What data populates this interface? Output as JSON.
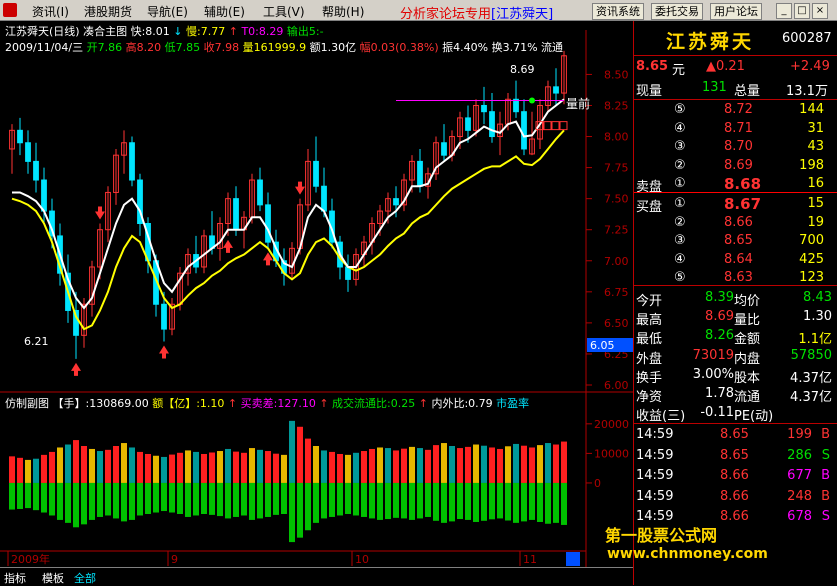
{
  "menubar": {
    "items": [
      "资讯(I)",
      "港股期货",
      "导航(E)",
      "辅助(E)",
      "工具(V)",
      "帮助(H)"
    ],
    "promo": "分析家论坛专用",
    "promo_bracket": "[江苏舜天]",
    "buttons": [
      "资讯系统",
      "委托交易",
      "用户论坛"
    ],
    "controls": [
      "_",
      "□",
      "×"
    ]
  },
  "header": {
    "line1": {
      "title": "江苏舜天(日线)",
      "indicator": "凑合主图",
      "fast": "快:8.01",
      "slow": "慢:7.77",
      "t0": "T0:8.29",
      "output": "输出5:-"
    },
    "line2": {
      "date": "2009/11/04/三",
      "open": "开7.86",
      "high": "高8.20",
      "low": "低7.85",
      "close": "收7.98",
      "volume": "量161999.9",
      "amount": "额1.30亿",
      "change": "幅0.03(0.38%)",
      "amplitude": "振4.40%",
      "turnover": "换3.71%",
      "float": "流通"
    },
    "annot_high": "8.69",
    "annot_low": "6.21",
    "annot_right": "量前"
  },
  "price_axis": {
    "ticks": [
      "8.50",
      "8.25",
      "8.00",
      "7.75",
      "7.50",
      "7.25",
      "7.00",
      "6.75",
      "6.50",
      "6.25",
      "6.00"
    ],
    "current_tag": "6.05"
  },
  "sub_indicator": {
    "name": "仿制副图",
    "hand": "【手】:130869.00",
    "amount": "额【亿】:1.10",
    "buysell": "买卖差:127.10",
    "float_ratio": "成交流通比:0.25",
    "inout_ratio": "内外比:0.79",
    "pe": "市盈率",
    "axis": [
      "20000",
      "10000",
      "0"
    ]
  },
  "time_axis": [
    "2009年",
    "9",
    "10",
    "11"
  ],
  "bottom_tabs": [
    "指标",
    "模板",
    "全部"
  ],
  "quote": {
    "name": "江苏舜天",
    "code": "600287",
    "price": "8.65",
    "price_unit": "元",
    "change": "▲0.21",
    "change_pct": "+2.49",
    "now_vol_label": "现量",
    "now_vol": "131",
    "total_vol_label": "总量",
    "total_vol": "13.1万",
    "asks": [
      {
        "level": "⑤",
        "price": "8.72",
        "vol": "144"
      },
      {
        "level": "④",
        "price": "8.71",
        "vol": "31"
      },
      {
        "level": "③",
        "price": "8.70",
        "vol": "43"
      },
      {
        "level": "②",
        "price": "8.69",
        "vol": "198"
      },
      {
        "level": "①",
        "price": "8.68",
        "vol": "16",
        "label": "卖盘"
      }
    ],
    "bids": [
      {
        "level": "①",
        "price": "8.67",
        "vol": "15",
        "label": "买盘"
      },
      {
        "level": "②",
        "price": "8.66",
        "vol": "19"
      },
      {
        "level": "③",
        "price": "8.65",
        "vol": "700"
      },
      {
        "level": "④",
        "price": "8.64",
        "vol": "425"
      },
      {
        "level": "⑤",
        "price": "8.63",
        "vol": "123"
      }
    ],
    "stats": [
      {
        "l1": "今开",
        "v1": "8.39",
        "l2": "均价",
        "v2": "8.43",
        "c1": "#00e000",
        "c2": "#00e000"
      },
      {
        "l1": "最高",
        "v1": "8.69",
        "l2": "量比",
        "v2": "1.30",
        "c1": "#ff3333",
        "c2": "#ffffff"
      },
      {
        "l1": "最低",
        "v1": "8.26",
        "l2": "金额",
        "v2": "1.1亿",
        "c1": "#00e000",
        "c2": "#ffff00"
      },
      {
        "l1": "外盘",
        "v1": "73019",
        "l2": "内盘",
        "v2": "57850",
        "c1": "#ff3333",
        "c2": "#00e000"
      },
      {
        "l1": "换手",
        "v1": "3.00%",
        "l2": "股本",
        "v2": "4.37亿",
        "c1": "#ffffff",
        "c2": "#ffffff"
      },
      {
        "l1": "净资",
        "v1": "1.78",
        "l2": "流通",
        "v2": "4.37亿",
        "c1": "#ffffff",
        "c2": "#ffffff"
      },
      {
        "l1": "收益(三)",
        "v1": "-0.11",
        "l2": "PE(动)",
        "v2": "",
        "c1": "#ffffff",
        "c2": "#ffffff"
      }
    ],
    "ticks": [
      {
        "time": "14:59",
        "price": "8.65",
        "vol": "199",
        "flag": "B",
        "fc": "#ff3333"
      },
      {
        "time": "14:59",
        "price": "8.65",
        "vol": "286",
        "flag": "S",
        "fc": "#00e000"
      },
      {
        "time": "14:59",
        "price": "8.66",
        "vol": "677",
        "flag": "B",
        "fc": "#ff00ff"
      },
      {
        "time": "14:59",
        "price": "8.66",
        "vol": "248",
        "flag": "B",
        "fc": "#ff3333"
      },
      {
        "time": "14:59",
        "price": "8.66",
        "vol": "678",
        "flag": "S",
        "fc": "#ff00ff"
      }
    ]
  },
  "watermark": {
    "line1": "第一股票公式网",
    "line2": "www.chnmoney.com"
  },
  "colors": {
    "up": "#ff3333",
    "down": "#00e5ff",
    "fast_line": "#ffffff",
    "slow_line": "#ffff00",
    "vol_up": "#ff2020",
    "vol_alt": "#e8b800",
    "vol_teal": "#009999",
    "vol_neg": "#00c000"
  },
  "chart_data": {
    "type": "candlestick",
    "ylim": [
      6.0,
      8.6
    ],
    "candles": [
      [
        7.9,
        8.1,
        7.7,
        8.05
      ],
      [
        8.05,
        8.15,
        7.85,
        7.95
      ],
      [
        7.95,
        8.05,
        7.7,
        7.8
      ],
      [
        7.8,
        7.95,
        7.55,
        7.65
      ],
      [
        7.65,
        7.75,
        7.3,
        7.4
      ],
      [
        7.4,
        7.5,
        7.1,
        7.2
      ],
      [
        7.2,
        7.3,
        6.8,
        6.9
      ],
      [
        6.9,
        7.05,
        6.5,
        6.6
      ],
      [
        6.6,
        6.75,
        6.21,
        6.4
      ],
      [
        6.4,
        6.7,
        6.3,
        6.65
      ],
      [
        6.65,
        7.0,
        6.55,
        6.95
      ],
      [
        6.95,
        7.3,
        6.85,
        7.25
      ],
      [
        7.25,
        7.6,
        7.15,
        7.55
      ],
      [
        7.55,
        7.9,
        7.45,
        7.85
      ],
      [
        7.85,
        8.05,
        7.7,
        7.95
      ],
      [
        7.95,
        8.0,
        7.6,
        7.65
      ],
      [
        7.65,
        7.7,
        7.2,
        7.3
      ],
      [
        7.3,
        7.35,
        6.9,
        7.0
      ],
      [
        7.0,
        7.05,
        6.55,
        6.65
      ],
      [
        6.65,
        6.75,
        6.35,
        6.45
      ],
      [
        6.45,
        6.7,
        6.4,
        6.65
      ],
      [
        6.65,
        6.95,
        6.6,
        6.9
      ],
      [
        6.9,
        7.1,
        6.8,
        7.05
      ],
      [
        7.05,
        7.2,
        6.9,
        6.95
      ],
      [
        6.95,
        7.25,
        6.9,
        7.2
      ],
      [
        7.2,
        7.4,
        7.05,
        7.1
      ],
      [
        7.1,
        7.35,
        7.0,
        7.3
      ],
      [
        7.3,
        7.55,
        7.2,
        7.5
      ],
      [
        7.5,
        7.6,
        7.2,
        7.25
      ],
      [
        7.25,
        7.4,
        7.1,
        7.35
      ],
      [
        7.35,
        7.7,
        7.3,
        7.65
      ],
      [
        7.65,
        7.75,
        7.4,
        7.45
      ],
      [
        7.45,
        7.55,
        7.1,
        7.15
      ],
      [
        7.15,
        7.25,
        6.95,
        7.0
      ],
      [
        7.0,
        7.1,
        6.8,
        6.9
      ],
      [
        6.9,
        7.15,
        6.85,
        7.1
      ],
      [
        7.1,
        7.5,
        7.05,
        7.45
      ],
      [
        7.45,
        7.9,
        7.4,
        7.8
      ],
      [
        7.8,
        8.0,
        7.55,
        7.6
      ],
      [
        7.6,
        7.75,
        7.35,
        7.4
      ],
      [
        7.4,
        7.5,
        7.1,
        7.15
      ],
      [
        7.15,
        7.2,
        6.85,
        6.95
      ],
      [
        6.95,
        7.05,
        6.75,
        6.85
      ],
      [
        6.85,
        7.1,
        6.8,
        7.05
      ],
      [
        7.05,
        7.2,
        6.95,
        7.15
      ],
      [
        7.15,
        7.35,
        7.05,
        7.3
      ],
      [
        7.3,
        7.45,
        7.2,
        7.4
      ],
      [
        7.4,
        7.55,
        7.3,
        7.5
      ],
      [
        7.5,
        7.6,
        7.35,
        7.45
      ],
      [
        7.45,
        7.7,
        7.4,
        7.65
      ],
      [
        7.65,
        7.85,
        7.55,
        7.8
      ],
      [
        7.8,
        7.9,
        7.55,
        7.6
      ],
      [
        7.6,
        7.75,
        7.5,
        7.7
      ],
      [
        7.7,
        8.0,
        7.65,
        7.95
      ],
      [
        7.95,
        8.1,
        7.8,
        7.85
      ],
      [
        7.85,
        8.05,
        7.8,
        8.0
      ],
      [
        8.0,
        8.2,
        7.9,
        8.15
      ],
      [
        8.15,
        8.25,
        7.95,
        8.05
      ],
      [
        8.05,
        8.3,
        8.0,
        8.25
      ],
      [
        8.25,
        8.4,
        8.1,
        8.2
      ],
      [
        8.2,
        8.35,
        7.95,
        8.0
      ],
      [
        8.0,
        8.2,
        7.85,
        8.1
      ],
      [
        8.1,
        8.35,
        8.05,
        8.3
      ],
      [
        8.3,
        8.45,
        8.15,
        8.2
      ],
      [
        8.2,
        8.3,
        7.85,
        7.9
      ],
      [
        7.86,
        8.2,
        7.85,
        7.98
      ],
      [
        7.98,
        8.3,
        7.9,
        8.25
      ],
      [
        8.25,
        8.45,
        8.2,
        8.4
      ],
      [
        8.4,
        8.55,
        8.25,
        8.35
      ],
      [
        8.35,
        8.69,
        8.26,
        8.65
      ]
    ],
    "fast": [
      7.55,
      7.55,
      7.52,
      7.48,
      7.4,
      7.25,
      7.05,
      6.85,
      6.7,
      6.62,
      6.7,
      6.9,
      7.1,
      7.3,
      7.45,
      7.5,
      7.4,
      7.2,
      7.0,
      6.82,
      6.75,
      6.85,
      6.95,
      7.0,
      7.05,
      7.1,
      7.15,
      7.25,
      7.25,
      7.25,
      7.35,
      7.35,
      7.25,
      7.1,
      6.98,
      6.95,
      7.1,
      7.35,
      7.45,
      7.4,
      7.25,
      7.05,
      6.95,
      6.95,
      7.05,
      7.15,
      7.25,
      7.35,
      7.4,
      7.48,
      7.6,
      7.6,
      7.62,
      7.75,
      7.8,
      7.85,
      7.95,
      7.98,
      8.03,
      8.08,
      8.05,
      8.03,
      8.1,
      8.12,
      8.0,
      8.01,
      8.1,
      8.2,
      8.25,
      8.3
    ],
    "slow": [
      7.5,
      7.48,
      7.45,
      7.4,
      7.3,
      7.15,
      6.95,
      6.75,
      6.55,
      6.45,
      6.48,
      6.6,
      6.75,
      6.95,
      7.1,
      7.2,
      7.15,
      7.0,
      6.85,
      6.7,
      6.62,
      6.65,
      6.72,
      6.78,
      6.82,
      6.88,
      6.92,
      6.98,
      7.02,
      7.05,
      7.1,
      7.15,
      7.1,
      7.0,
      6.9,
      6.85,
      6.9,
      7.05,
      7.15,
      7.18,
      7.12,
      7.02,
      6.95,
      6.92,
      6.95,
      7.0,
      7.05,
      7.12,
      7.18,
      7.22,
      7.3,
      7.35,
      7.38,
      7.45,
      7.52,
      7.58,
      7.62,
      7.66,
      7.7,
      7.74,
      7.76,
      7.76,
      7.8,
      7.84,
      7.78,
      7.77,
      7.82,
      7.9,
      7.98,
      8.05
    ],
    "volume": [
      9000,
      8500,
      7800,
      8200,
      9500,
      10500,
      12000,
      13000,
      14500,
      12500,
      11500,
      10800,
      11200,
      12500,
      13500,
      12000,
      10500,
      9800,
      9200,
      8800,
      9600,
      10200,
      11000,
      10500,
      9800,
      10300,
      10800,
      11500,
      10600,
      10200,
      11800,
      11200,
      10800,
      9900,
      9500,
      21000,
      19000,
      15000,
      12500,
      11000,
      10500,
      9800,
      9500,
      10200,
      10800,
      11500,
      12000,
      11800,
      11000,
      11600,
      12200,
      11800,
      11200,
      12800,
      13500,
      12500,
      11800,
      12200,
      13000,
      12600,
      12000,
      11500,
      12400,
      13200,
      12600,
      12000,
      12800,
      13500,
      13000,
      14000
    ],
    "volume_neg": [
      -9000,
      -8800,
      -8500,
      -9200,
      -10000,
      -11000,
      -12500,
      -13500,
      -15000,
      -14000,
      -12500,
      -11500,
      -11000,
      -12000,
      -13000,
      -12500,
      -11000,
      -10500,
      -10000,
      -9500,
      -10000,
      -10500,
      -11500,
      -11000,
      -10500,
      -10800,
      -11200,
      -12000,
      -11500,
      -11000,
      -12500,
      -12000,
      -11500,
      -10800,
      -10500,
      -20000,
      -18500,
      -16000,
      -13500,
      -12000,
      -11500,
      -11000,
      -10500,
      -11000,
      -11500,
      -12000,
      -12500,
      -12200,
      -11800,
      -12000,
      -12500,
      -12000,
      -11500,
      -12800,
      -13500,
      -13000,
      -12200,
      -12500,
      -13200,
      -12800,
      -12300,
      -12000,
      -12700,
      -13500,
      -13000,
      -12500,
      -13200,
      -13800,
      -13500,
      -14200
    ],
    "vol_ylim": [
      -22000,
      24000
    ],
    "up_arrows": [
      8,
      19,
      27,
      32
    ],
    "down_arrows": [
      11,
      36
    ],
    "marker_index": 65
  }
}
